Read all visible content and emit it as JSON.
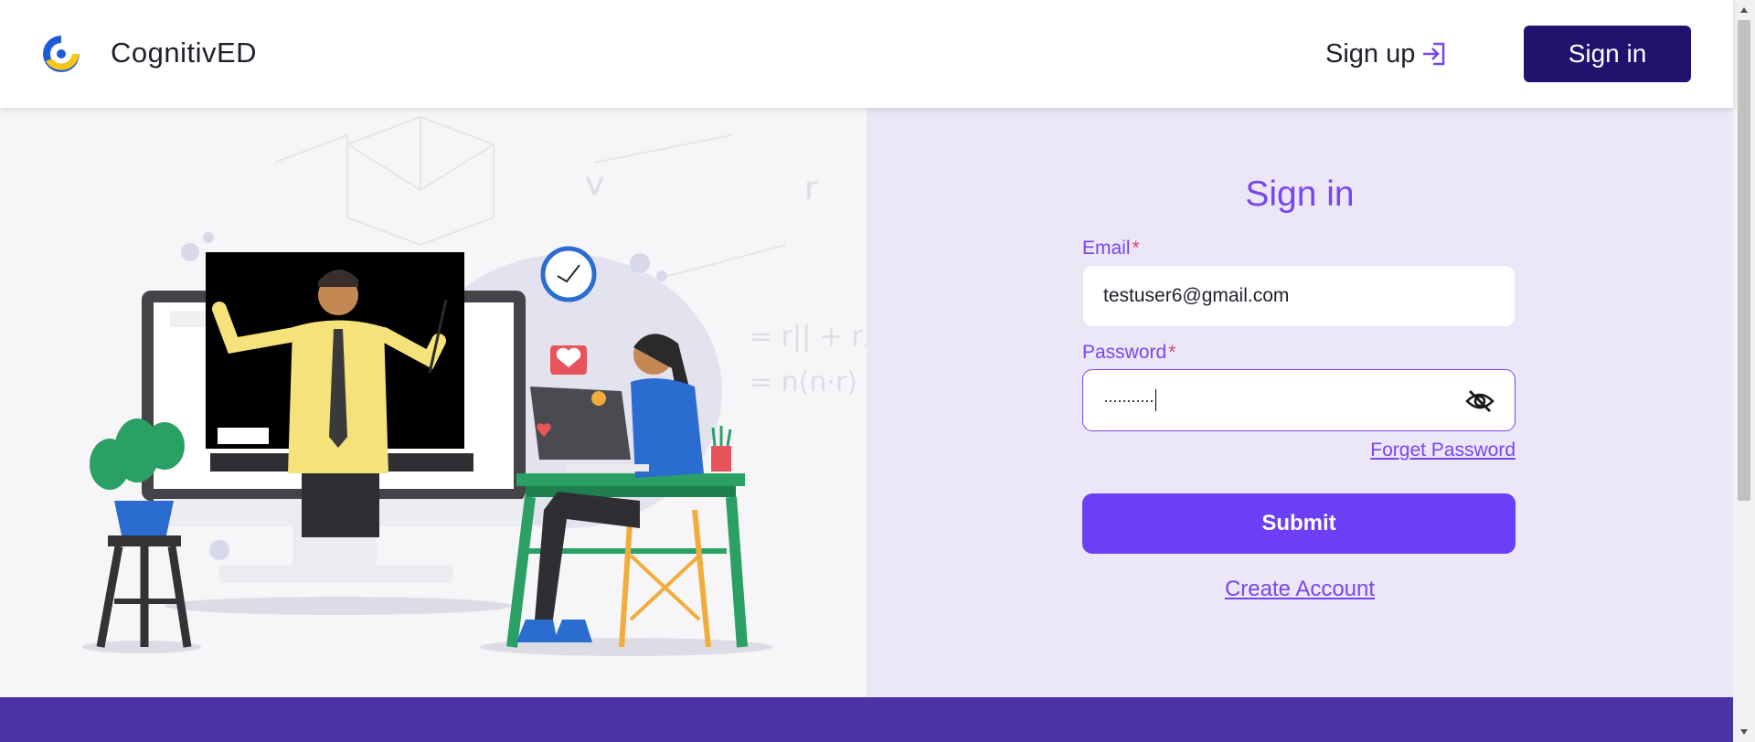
{
  "header": {
    "brand": "CognitivED",
    "signup_label": "Sign up",
    "signin_label": "Sign in"
  },
  "form": {
    "title": "Sign in",
    "email_label": "Email",
    "email_value": "testuser6@gmail.com",
    "password_label": "Password",
    "password_value": "···········",
    "required_mark": "*",
    "forget_label": "Forget Password",
    "submit_label": "Submit",
    "create_account_label": "Create Account"
  },
  "colors": {
    "accent": "#7a45f0",
    "dark_button": "#22126e",
    "submit": "#6c3ef5",
    "footer": "#4c33a5",
    "panel": "#ebe7f6"
  },
  "icons": {
    "logo": "brand-logo-icon",
    "signup": "sign-in-arrow-icon",
    "password_toggle": "eye-off-icon"
  }
}
